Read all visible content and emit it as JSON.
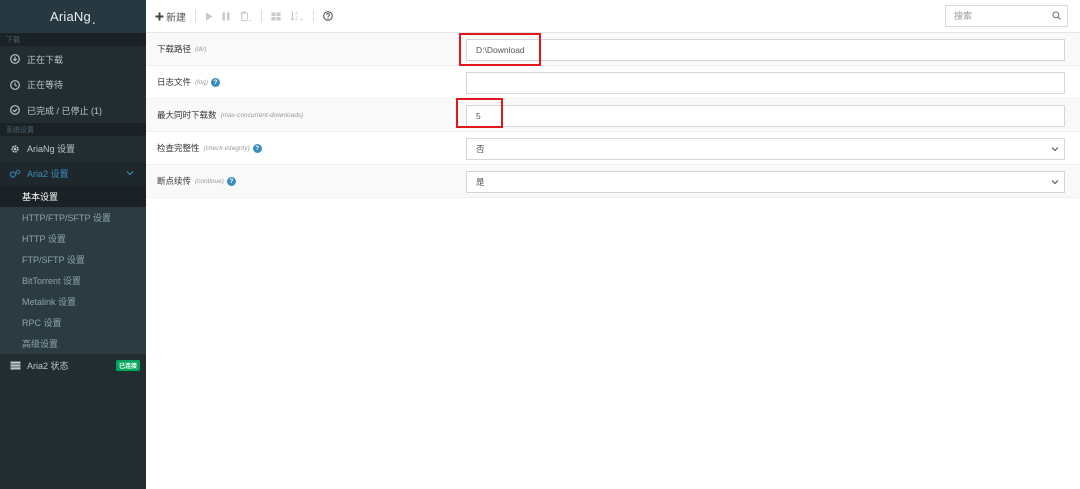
{
  "app": {
    "title": "AriaNg",
    "title_dot": "."
  },
  "sidebar": {
    "section_download": "下载",
    "download_items": [
      {
        "label": "正在下载",
        "icon": "download-circle-icon"
      },
      {
        "label": "正在等待",
        "icon": "clock-icon"
      },
      {
        "label": "已完成 / 已停止 (1)",
        "icon": "check-circle-icon"
      }
    ],
    "section_settings": "系统设置",
    "ariang_settings": "AriaNg 设置",
    "aria2_settings": "Aria2 设置",
    "aria2_sub": [
      "基本设置",
      "HTTP/FTP/SFTP 设置",
      "HTTP 设置",
      "FTP/SFTP 设置",
      "BitTorrent 设置",
      "Metalink 设置",
      "RPC 设置",
      "高级设置"
    ],
    "aria2_status": "Aria2 状态",
    "aria2_status_badge": "已连接"
  },
  "toolbar": {
    "new_label": "新建",
    "search_placeholder": "搜索"
  },
  "settings": [
    {
      "label": "下载路径",
      "key": "(dir)",
      "help": false,
      "value": "D:\\Download",
      "type": "text"
    },
    {
      "label": "日志文件",
      "key": "(log)",
      "help": true,
      "value": "",
      "type": "text"
    },
    {
      "label": "最大同时下载数",
      "key": "(max-concurrent-downloads)",
      "help": false,
      "value": "5",
      "type": "text"
    },
    {
      "label": "检查完整性",
      "key": "(check-integrity)",
      "help": true,
      "value": "否",
      "type": "select"
    },
    {
      "label": "断点续传",
      "key": "(continue)",
      "help": true,
      "value": "是",
      "type": "select"
    }
  ],
  "colors": {
    "accent": "#3c8dbc",
    "sidebar_bg": "#222d32",
    "highlight": "#e0181e",
    "badge": "#00a65a"
  }
}
